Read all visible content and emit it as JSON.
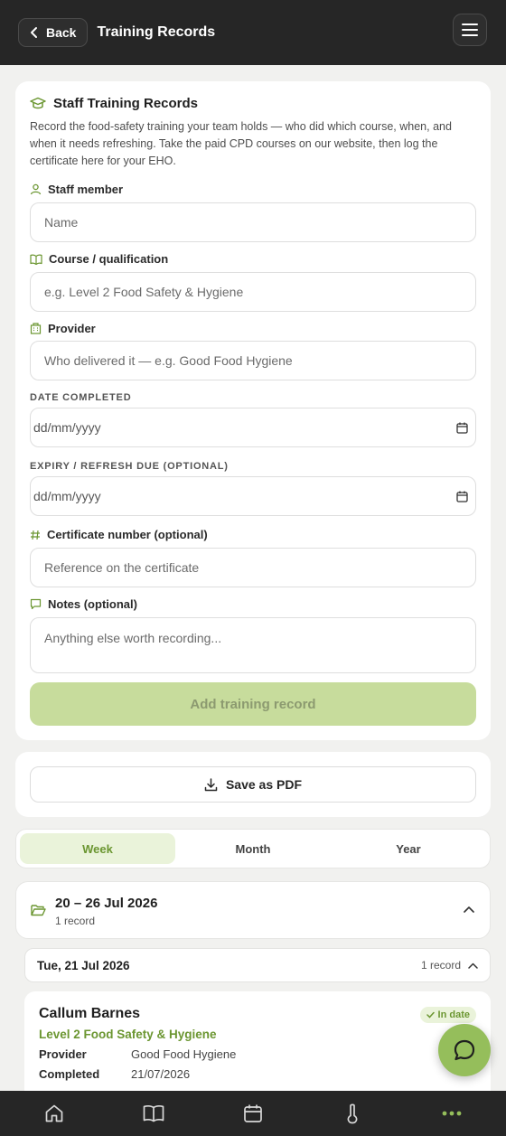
{
  "topbar": {
    "back_label": "Back",
    "title": "Training Records"
  },
  "form": {
    "title": "Staff Training Records",
    "intro": "Record the food-safety training your team holds — who did which course, when, and when it needs refreshing. Take the paid CPD courses on our website, then log the certificate here for your EHO.",
    "staff_label": "Staff member",
    "staff_placeholder": "Name",
    "course_label": "Course / qualification",
    "course_placeholder": "e.g. Level 2 Food Safety & Hygiene",
    "provider_label": "Provider",
    "provider_placeholder": "Who delivered it — e.g. Good Food Hygiene",
    "completed_label": "DATE COMPLETED",
    "completed_placeholder": "dd/mm/yyyy",
    "expiry_label": "EXPIRY / REFRESH DUE (OPTIONAL)",
    "expiry_placeholder": "dd/mm/yyyy",
    "cert_label": "Certificate number (optional)",
    "cert_placeholder": "Reference on the certificate",
    "notes_label": "Notes (optional)",
    "notes_placeholder": "Anything else worth recording...",
    "submit_label": "Add training record"
  },
  "pdf": {
    "label": "Save as PDF"
  },
  "segments": [
    {
      "label": "Week",
      "active": true
    },
    {
      "label": "Month",
      "active": false
    },
    {
      "label": "Year",
      "active": false
    }
  ],
  "week_group": {
    "title": "20 – 26 Jul 2026",
    "count": "1 record"
  },
  "day_group": {
    "title": "Tue, 21 Jul 2026",
    "count": "1 record"
  },
  "record": {
    "name": "Callum Barnes",
    "course": "Level 2 Food Safety & Hygiene",
    "status": "In date",
    "provider_key": "Provider",
    "provider_val": "Good Food Hygiene",
    "completed_key": "Completed",
    "completed_val": "21/07/2026"
  },
  "icons": {
    "nav": [
      "home-icon",
      "book-icon",
      "calendar-icon",
      "thermometer-icon",
      "more-icon"
    ]
  },
  "colors": {
    "accent": "#6b9631",
    "fab": "#95be5b",
    "bar": "#262626"
  }
}
